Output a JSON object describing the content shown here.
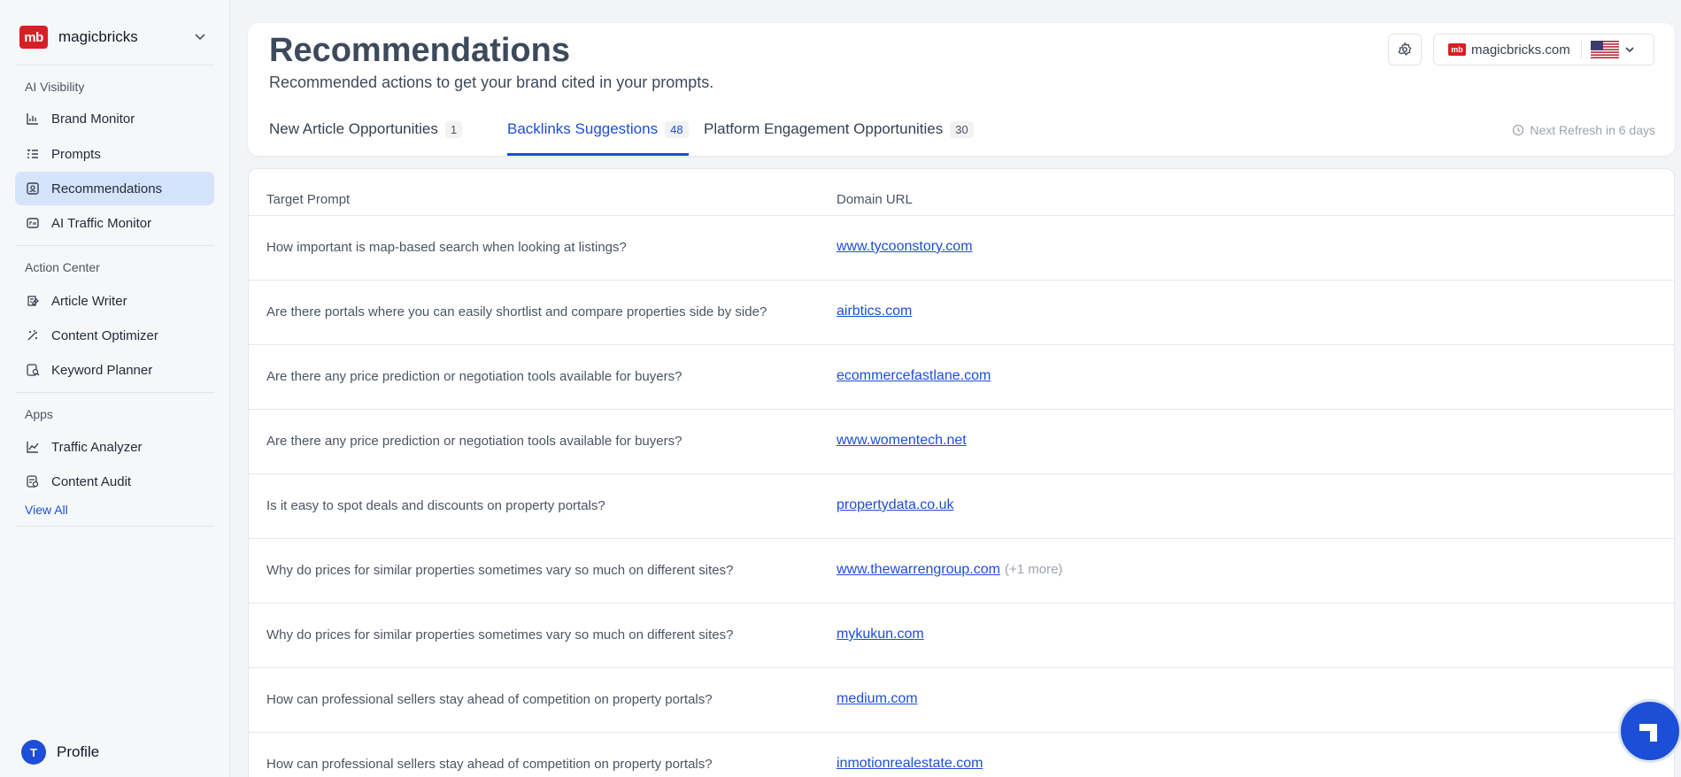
{
  "brand": {
    "logo": "mb",
    "name": "magicbricks"
  },
  "sidebar": {
    "sections": [
      {
        "label": "AI Visibility"
      },
      {
        "label": "Action Center"
      },
      {
        "label": "Apps"
      }
    ],
    "items": [
      {
        "label": "Brand Monitor",
        "icon": "bar-chart-icon"
      },
      {
        "label": "Prompts",
        "icon": "list-icon"
      },
      {
        "label": "Recommendations",
        "icon": "recommendations-icon",
        "active": true
      },
      {
        "label": "AI Traffic Monitor",
        "icon": "ai-traffic-icon"
      },
      {
        "label": "Article Writer",
        "icon": "article-writer-icon"
      },
      {
        "label": "Content Optimizer",
        "icon": "wand-icon"
      },
      {
        "label": "Keyword Planner",
        "icon": "keyword-icon"
      },
      {
        "label": "Traffic Analyzer",
        "icon": "line-chart-icon"
      },
      {
        "label": "Content Audit",
        "icon": "audit-icon"
      }
    ],
    "view_all": "View All",
    "profile": {
      "initial": "T",
      "label": "Profile"
    }
  },
  "header": {
    "title": "Recommendations",
    "subtitle": "Recommended actions to get your brand cited in your prompts.",
    "domain_logo": "mb",
    "domain": "magicbricks.com",
    "refresh": "Next Refresh in 6 days",
    "tabs": [
      {
        "label": "New Article Opportunities",
        "count": "1"
      },
      {
        "label": "Backlinks Suggestions",
        "count": "48",
        "active": true
      },
      {
        "label": "Platform Engagement Opportunities",
        "count": "30"
      }
    ]
  },
  "table": {
    "headers": [
      "Target Prompt",
      "Domain URL"
    ],
    "rows": [
      {
        "prompt": "How important is map-based search when looking at listings?",
        "url": "www.tycoonstory.com",
        "more": ""
      },
      {
        "prompt": "Are there portals where you can easily shortlist and compare properties side by side?",
        "url": "airbtics.com",
        "more": ""
      },
      {
        "prompt": "Are there any price prediction or negotiation tools available for buyers?",
        "url": "ecommercefastlane.com",
        "more": ""
      },
      {
        "prompt": "Are there any price prediction or negotiation tools available for buyers?",
        "url": "www.womentech.net",
        "more": ""
      },
      {
        "prompt": "Is it easy to spot deals and discounts on property portals?",
        "url": "propertydata.co.uk",
        "more": ""
      },
      {
        "prompt": "Why do prices for similar properties sometimes vary so much on different sites?",
        "url": "www.thewarrengroup.com",
        "more": "(+1 more)"
      },
      {
        "prompt": "Why do prices for similar properties sometimes vary so much on different sites?",
        "url": "mykukun.com",
        "more": ""
      },
      {
        "prompt": "How can professional sellers stay ahead of competition on property portals?",
        "url": "medium.com",
        "more": ""
      },
      {
        "prompt": "How can professional sellers stay ahead of competition on property portals?",
        "url": "inmotionrealestate.com",
        "more": ""
      }
    ]
  },
  "colors": {
    "accent": "#1d4ed8",
    "brand": "#d71f26",
    "active_bg": "#d6e4fb"
  }
}
